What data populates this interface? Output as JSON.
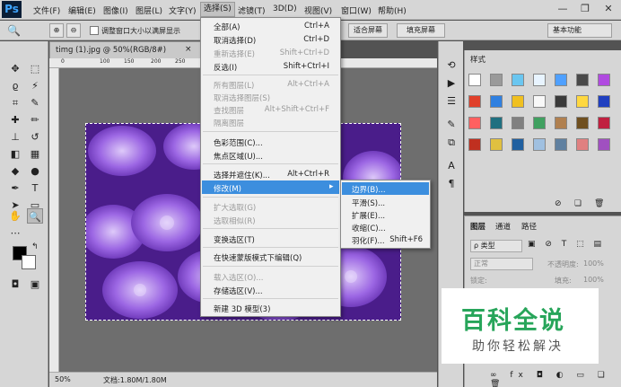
{
  "menubar": {
    "logo": "Ps",
    "items": [
      "文件(F)",
      "编辑(E)",
      "图像(I)",
      "图层(L)",
      "文字(Y)",
      "选择(S)",
      "滤镜(T)",
      "3D(D)",
      "视图(V)",
      "窗口(W)",
      "帮助(H)"
    ],
    "window_controls": [
      "—",
      "❐",
      "✕"
    ]
  },
  "options": {
    "resize_windows": "调整窗口大小以满屏显示",
    "fit_screen": "适合屏幕",
    "fill_screen": "填充屏幕",
    "workspace": "基本功能"
  },
  "document": {
    "tab_title": "timg (1).jpg @ 50%(RGB/8#)",
    "tab_close": "×",
    "zoom": "50%",
    "doc_info": "文档:1.80M/1.80M",
    "ruler_labels": [
      "0",
      "100",
      "150",
      "200",
      "250",
      "300",
      "350",
      "400",
      "450",
      "500",
      "550",
      "600",
      "650",
      "700",
      "750",
      "800",
      "850"
    ]
  },
  "select_menu": {
    "items": [
      {
        "label": "全部(A)",
        "shortcut": "Ctrl+A",
        "disabled": false
      },
      {
        "label": "取消选择(D)",
        "shortcut": "Ctrl+D",
        "disabled": false
      },
      {
        "label": "重新选择(E)",
        "shortcut": "Shift+Ctrl+D",
        "disabled": true
      },
      {
        "label": "反选(I)",
        "shortcut": "Shift+Ctrl+I",
        "disabled": false
      },
      {
        "label": "所有图层(L)",
        "shortcut": "Alt+Ctrl+A",
        "disabled": true
      },
      {
        "label": "取消选择图层(S)",
        "shortcut": "",
        "disabled": true
      },
      {
        "label": "查找图层",
        "shortcut": "Alt+Shift+Ctrl+F",
        "disabled": true
      },
      {
        "label": "隔离图层",
        "shortcut": "",
        "disabled": true
      },
      {
        "label": "色彩范围(C)...",
        "shortcut": "",
        "disabled": false
      },
      {
        "label": "焦点区域(U)...",
        "shortcut": "",
        "disabled": false
      },
      {
        "label": "选择并遮住(K)...",
        "shortcut": "Alt+Ctrl+R",
        "disabled": false
      },
      {
        "label": "修改(M)",
        "shortcut": "",
        "disabled": false,
        "highlighted": true
      },
      {
        "label": "扩大选取(G)",
        "shortcut": "",
        "disabled": true
      },
      {
        "label": "选取相似(R)",
        "shortcut": "",
        "disabled": true
      },
      {
        "label": "变换选区(T)",
        "shortcut": "",
        "disabled": false
      },
      {
        "label": "在快速蒙版模式下编辑(Q)",
        "shortcut": "",
        "disabled": false
      },
      {
        "label": "载入选区(O)...",
        "shortcut": "",
        "disabled": true
      },
      {
        "label": "存储选区(V)...",
        "shortcut": "",
        "disabled": false
      },
      {
        "label": "新建 3D 模型(3)",
        "shortcut": "",
        "disabled": false
      }
    ],
    "submenu_arrow": "▸"
  },
  "modify_submenu": {
    "items": [
      {
        "label": "边界(B)...",
        "shortcut": "",
        "highlighted": true
      },
      {
        "label": "平滑(S)...",
        "shortcut": ""
      },
      {
        "label": "扩展(E)...",
        "shortcut": ""
      },
      {
        "label": "收缩(C)...",
        "shortcut": ""
      },
      {
        "label": "羽化(F)...",
        "shortcut": "Shift+F6"
      }
    ]
  },
  "styles_panel": {
    "title": "样式"
  },
  "layers_panel": {
    "tabs": [
      "图层",
      "通道",
      "路径"
    ],
    "kind_filter": "ρ 类型",
    "blend_mode": "正常",
    "opacity_label": "不透明度:",
    "opacity_value": "100%",
    "lock_label": "锁定:",
    "fill_label": "填充:",
    "fill_value": "100%"
  },
  "watermark": {
    "title": "百科全说",
    "subtitle": "助你轻松解决"
  },
  "colors": {
    "accent": "#3c8ede",
    "flower": "#8a55d6",
    "panel": "#d6d6d6"
  }
}
